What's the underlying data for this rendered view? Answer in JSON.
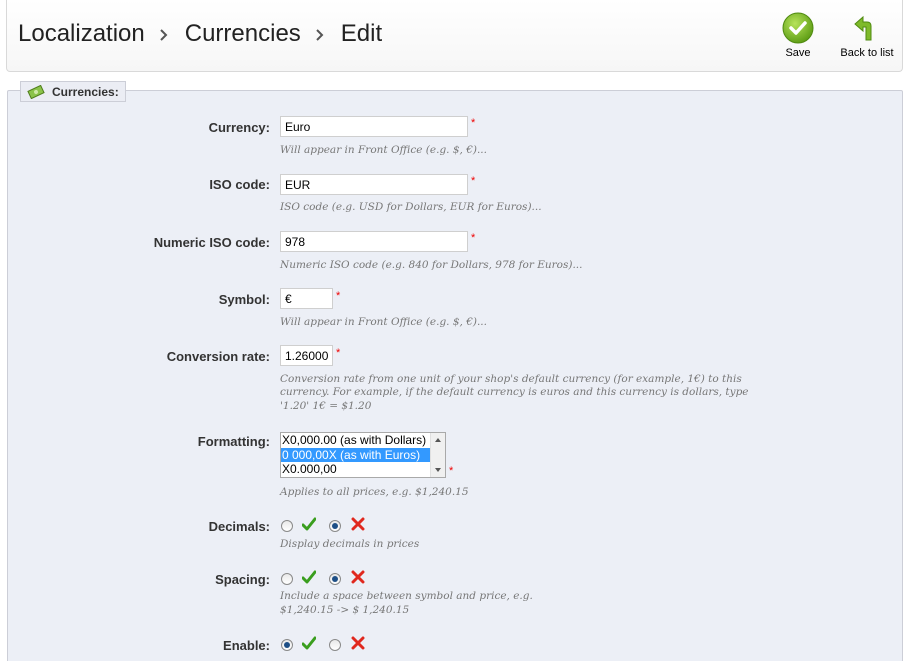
{
  "breadcrumb": [
    "Localization",
    "Currencies",
    "Edit"
  ],
  "toolbar": {
    "save_label": "Save",
    "back_label": "Back to list"
  },
  "section": {
    "legend": "Currencies:"
  },
  "fields": {
    "currency": {
      "label": "Currency:",
      "value": "Euro",
      "hint": "Will appear in Front Office (e.g. $, €)..."
    },
    "iso_code": {
      "label": "ISO code:",
      "value": "EUR",
      "hint": "ISO code (e.g. USD for Dollars, EUR for Euros)..."
    },
    "numeric_iso": {
      "label": "Numeric ISO code:",
      "value": "978",
      "hint": "Numeric ISO code (e.g. 840 for Dollars, 978 for Euros)..."
    },
    "symbol": {
      "label": "Symbol:",
      "value": "€",
      "hint": "Will appear in Front Office (e.g. $, €)..."
    },
    "conversion_rate": {
      "label": "Conversion rate:",
      "value": "1.26000",
      "hint_lines": [
        "Conversion rate from one unit of your shop's default currency (for example, 1€) to this",
        "currency. For example, if the default currency is euros and this currency is dollars, type",
        "'1.20' 1€ = $1.20"
      ]
    },
    "formatting": {
      "label": "Formatting:",
      "options": [
        "X0,000.00 (as with Dollars)",
        "0 000,00X (as with Euros)",
        "X0.000,00"
      ],
      "selected_index": 1,
      "hint": "Applies to all prices, e.g. $1,240.15"
    },
    "decimals": {
      "label": "Decimals:",
      "value": false,
      "hint": "Display decimals in prices"
    },
    "spacing": {
      "label": "Spacing:",
      "value": false,
      "hint_lines": [
        "Include a space between symbol and price, e.g.",
        "$1,240.15 -> $ 1,240.15"
      ]
    },
    "enable": {
      "label": "Enable:",
      "value": true
    }
  },
  "required_marker": "*",
  "colors": {
    "selected_option": "#3399ff",
    "panel_bg": "#eceff6",
    "yes_green": "#3a9e1e",
    "no_red": "#e0281e"
  }
}
